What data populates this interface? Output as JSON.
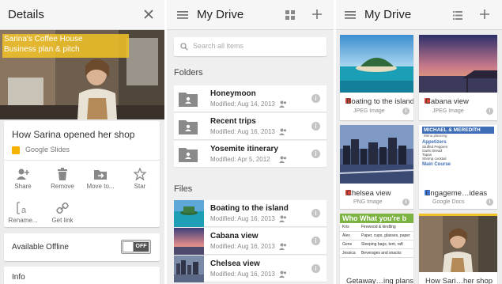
{
  "details": {
    "title": "Details",
    "hero_line1": "Sarina's Coffee House",
    "hero_line2": "Business plan & pitch",
    "doc_title": "How Sarina opened her shop",
    "doc_type": "Google Slides",
    "actions": [
      {
        "label": "Share",
        "icon": "add-person-icon"
      },
      {
        "label": "Remove",
        "icon": "trash-icon"
      },
      {
        "label": "Move to...",
        "icon": "move-folder-icon"
      },
      {
        "label": "Star",
        "icon": "star-icon"
      },
      {
        "label": "Rename...",
        "icon": "rename-icon"
      },
      {
        "label": "Get link",
        "icon": "link-icon"
      }
    ],
    "offline_label": "Available Offline",
    "toggle_text": "OFF",
    "info_label": "Info"
  },
  "drive_list": {
    "title": "My Drive",
    "search_placeholder": "Search all items",
    "folders_header": "Folders",
    "folders": [
      {
        "name": "Honeymoon",
        "modified": "Modified: Aug 14, 2013"
      },
      {
        "name": "Recent trips",
        "modified": "Modified: Aug 16, 2013"
      },
      {
        "name": "Yosemite itinerary",
        "modified": "Modified: Apr 5, 2012"
      }
    ],
    "files_header": "Files",
    "files": [
      {
        "name": "Boating to the island",
        "modified": "Modified: Aug 16, 2013"
      },
      {
        "name": "Cabana view",
        "modified": "Modified: Aug 16, 2013"
      },
      {
        "name": "Chelsea view",
        "modified": "Modified: Aug 16, 2013"
      }
    ]
  },
  "drive_grid": {
    "title": "My Drive",
    "tiles": [
      {
        "name": "Boating to the island",
        "type": "JPEG Image",
        "icon_color": "#db4437"
      },
      {
        "name": "Cabana view",
        "type": "JPEG Image",
        "icon_color": "#db4437"
      },
      {
        "name": "Chelsea view",
        "type": "PNG Image",
        "icon_color": "#db4437"
      },
      {
        "name": "Engageme…ideas",
        "type": "Google Docs",
        "icon_color": "#4285f4"
      },
      {
        "name": "Getaway…ing plans",
        "type": ""
      },
      {
        "name": "How Sari…her shop",
        "type": ""
      }
    ],
    "doc_preview": {
      "header": "MICHAEL & MEREDITH",
      "subheader": "Menu planning",
      "section1": "Appetizers",
      "items1": [
        "Stuffed Peppers",
        "Garlic Bread",
        "Tapas",
        "Shrimp cocktail"
      ],
      "section2": "Main Course"
    },
    "sheet_preview": {
      "header": "Who   What you're b",
      "rows": [
        {
          "who": "Kris",
          "what": "Firewood & kindling"
        },
        {
          "who": "Alex",
          "what": "Paper, cups, glasses, paper"
        },
        {
          "who": "Gene",
          "what": "Sleeping bags, tent, raft"
        },
        {
          "who": "Jessica",
          "what": "Beverages and snacks"
        }
      ]
    }
  },
  "colors": {
    "accent_yellow": "#f2c328",
    "slides_yellow": "#f4b400",
    "image_red": "#db4437",
    "docs_blue": "#4285f4",
    "sheets_green": "#0f9d58"
  }
}
